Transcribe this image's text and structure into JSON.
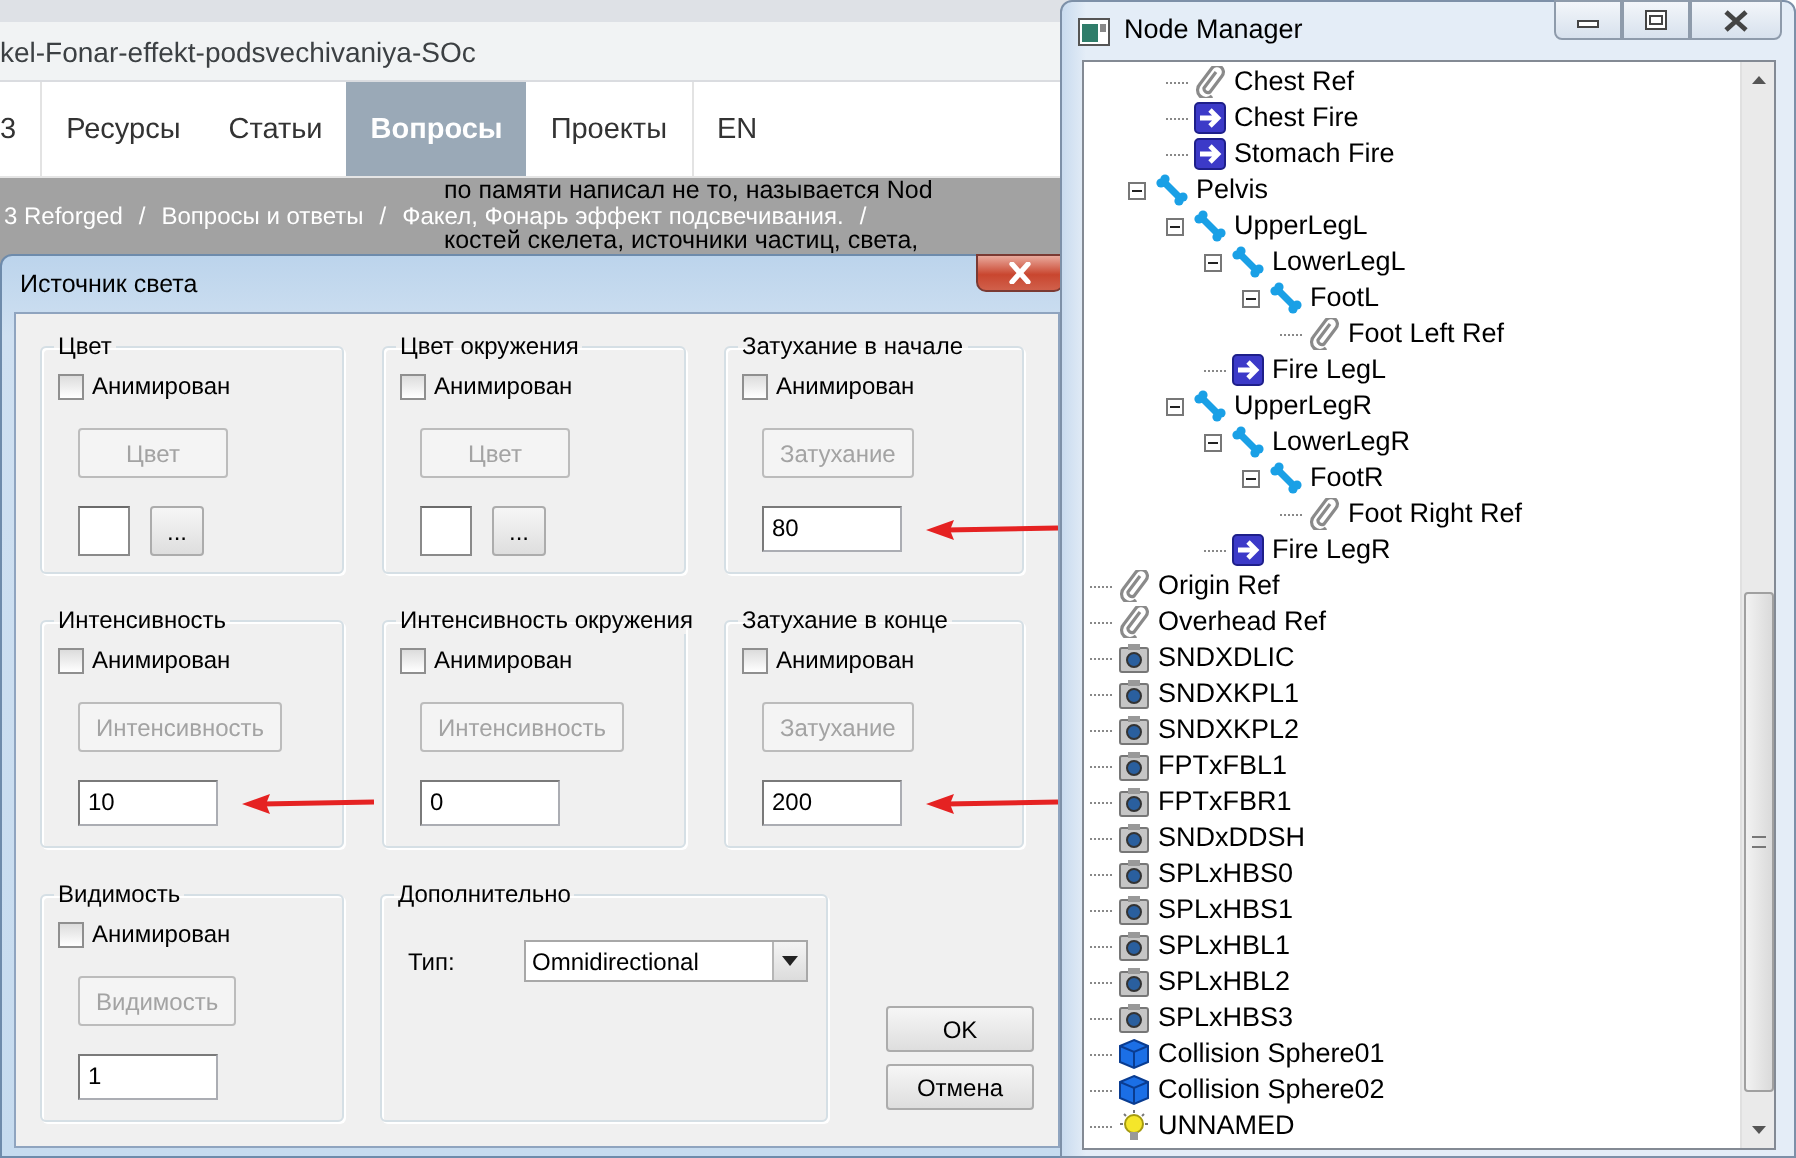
{
  "browser": {
    "address": "kel-Fonar-effekt-podsvechivaniya-SOc",
    "nav": [
      {
        "label": "3",
        "selected": false
      },
      {
        "label": "Ресурсы",
        "selected": false
      },
      {
        "label": "Статьи",
        "selected": false
      },
      {
        "label": "Вопросы",
        "selected": true
      },
      {
        "label": "Проекты",
        "selected": false
      },
      {
        "label": "EN",
        "selected": false
      }
    ],
    "breadcrumbs": [
      {
        "label": "3 Reforged",
        "separator": "/"
      },
      {
        "label": "Вопросы и ответы",
        "separator": "/"
      },
      {
        "label": "Факел, Фонарь эффект подсвечивания.",
        "separator": "/"
      }
    ],
    "post_lines": [
      "по памяти написал не то, называется Nod",
      "костей скелета, источники частиц, света,"
    ]
  },
  "dialog": {
    "title": "Источник света",
    "groups": [
      {
        "kind": "color",
        "title": "Цвет",
        "animated_label": "Анимирован",
        "animated": false,
        "button": "Цвет",
        "button_disabled": true,
        "picker": "...",
        "arrow": false
      },
      {
        "kind": "color",
        "title": "Цвет окружения",
        "animated_label": "Анимирован",
        "animated": false,
        "button": "Цвет",
        "button_disabled": true,
        "picker": "...",
        "arrow": false
      },
      {
        "kind": "value",
        "title": "Затухание в начале",
        "animated_label": "Анимирован",
        "animated": false,
        "button": "Затухание",
        "button_disabled": true,
        "value": "80",
        "arrow": true
      },
      {
        "kind": "value",
        "title": "Интенсивность",
        "animated_label": "Анимирован",
        "animated": false,
        "button": "Интенсивность",
        "button_disabled": true,
        "value": "10",
        "arrow": true
      },
      {
        "kind": "value",
        "title": "Интенсивность окружения",
        "animated_label": "Анимирован",
        "animated": false,
        "button": "Интенсивность",
        "button_disabled": true,
        "value": "0",
        "arrow": false
      },
      {
        "kind": "value",
        "title": "Затухание в конце",
        "animated_label": "Анимирован",
        "animated": false,
        "button": "Затухание",
        "button_disabled": true,
        "value": "200",
        "arrow": true
      },
      {
        "kind": "value",
        "title": "Видимость",
        "animated_label": "Анимирован",
        "animated": false,
        "button": "Видимость",
        "button_disabled": true,
        "value": "1",
        "arrow": false
      }
    ],
    "advanced": {
      "title": "Дополнительно",
      "type_label": "Тип:",
      "type_value": "Omnidirectional"
    },
    "buttons": [
      {
        "label": "OK"
      },
      {
        "label": "Отмена"
      }
    ]
  },
  "node_manager": {
    "title": "Node Manager",
    "tree": [
      {
        "children": [
          {
            "children": [
              {
                "label": "Chest Ref",
                "kind": "attachment"
              },
              {
                "label": "Chest Fire",
                "kind": "event"
              },
              {
                "label": "Stomach Fire",
                "kind": "event"
              }
            ]
          },
          {
            "label": "Pelvis",
            "kind": "bone",
            "expanded": true,
            "children": [
              {
                "label": "UpperLegL",
                "kind": "bone",
                "expanded": true,
                "children": [
                  {
                    "label": "LowerLegL",
                    "kind": "bone",
                    "expanded": true,
                    "children": [
                      {
                        "label": "FootL",
                        "kind": "bone",
                        "expanded": true,
                        "children": [
                          {
                            "label": "Foot Left Ref",
                            "kind": "attachment"
                          }
                        ]
                      }
                    ]
                  },
                  {
                    "label": "Fire LegL",
                    "kind": "event"
                  }
                ]
              },
              {
                "label": "UpperLegR",
                "kind": "bone",
                "expanded": true,
                "children": [
                  {
                    "label": "LowerLegR",
                    "kind": "bone",
                    "expanded": true,
                    "children": [
                      {
                        "label": "FootR",
                        "kind": "bone",
                        "expanded": true,
                        "children": [
                          {
                            "label": "Foot Right Ref",
                            "kind": "attachment"
                          }
                        ]
                      }
                    ]
                  },
                  {
                    "label": "Fire LegR",
                    "kind": "event"
                  }
                ]
              }
            ]
          }
        ]
      },
      {
        "label": "Origin Ref",
        "kind": "attachment"
      },
      {
        "label": "Overhead Ref",
        "kind": "attachment"
      },
      {
        "label": "SNDXDLIC",
        "kind": "camera"
      },
      {
        "label": "SNDXKPL1",
        "kind": "camera"
      },
      {
        "label": "SNDXKPL2",
        "kind": "camera"
      },
      {
        "label": "FPTxFBL1",
        "kind": "camera"
      },
      {
        "label": "FPTxFBR1",
        "kind": "camera"
      },
      {
        "label": "SNDxDDSH",
        "kind": "camera"
      },
      {
        "label": "SPLxHBS0",
        "kind": "camera"
      },
      {
        "label": "SPLxHBS1",
        "kind": "camera"
      },
      {
        "label": "SPLxHBL1",
        "kind": "camera"
      },
      {
        "label": "SPLxHBL2",
        "kind": "camera"
      },
      {
        "label": "SPLxHBS3",
        "kind": "camera"
      },
      {
        "label": "Collision Sphere01",
        "kind": "collision"
      },
      {
        "label": "Collision Sphere02",
        "kind": "collision"
      },
      {
        "label": "UNNAMED",
        "kind": "light"
      }
    ]
  }
}
